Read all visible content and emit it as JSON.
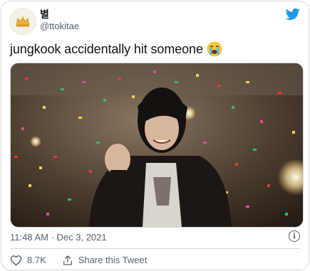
{
  "author": {
    "display_name": "별",
    "handle": "@ttokitae",
    "avatar_icon": "crown-avatar-icon"
  },
  "tweet": {
    "text": "jungkook accidentally hit someone",
    "emoji": "😭",
    "media_description_icon": "video-still",
    "timestamp": "11:48 AM · Dec 3, 2021"
  },
  "actions": {
    "like_count": "8.7K",
    "share_label": "Share this Tweet"
  },
  "colors": {
    "twitter_blue": "#1d9bf0",
    "secondary_text": "#536471",
    "border": "#cfd9de"
  }
}
